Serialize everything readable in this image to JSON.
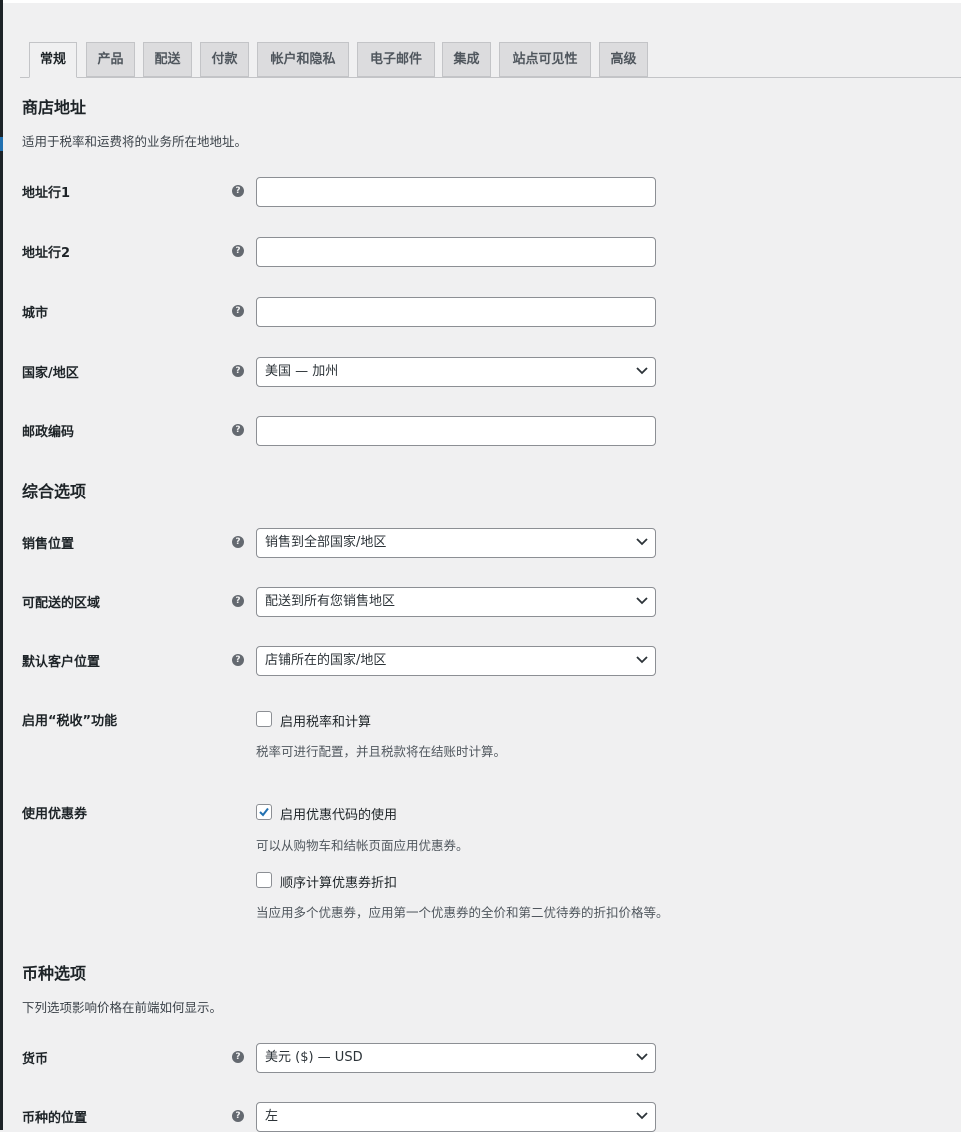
{
  "tabs": [
    {
      "label": "常规"
    },
    {
      "label": "产品"
    },
    {
      "label": "配送"
    },
    {
      "label": "付款"
    },
    {
      "label": "帐户和隐私"
    },
    {
      "label": "电子邮件"
    },
    {
      "label": "集成"
    },
    {
      "label": "站点可见性"
    },
    {
      "label": "高级"
    }
  ],
  "store_address": {
    "title": "商店地址",
    "description": "适用于税率和运费将的业务所在地地址。",
    "address1": {
      "label": "地址行1",
      "value": ""
    },
    "address2": {
      "label": "地址行2",
      "value": ""
    },
    "city": {
      "label": "城市",
      "value": ""
    },
    "country": {
      "label": "国家/地区",
      "value": "美国 — 加州"
    },
    "postcode": {
      "label": "邮政编码",
      "value": ""
    }
  },
  "general_options": {
    "title": "综合选项",
    "selling_location": {
      "label": "销售位置",
      "value": "销售到全部国家/地区"
    },
    "shipping_location": {
      "label": "可配送的区域",
      "value": "配送到所有您销售地区"
    },
    "default_customer_location": {
      "label": "默认客户位置",
      "value": "店铺所在的国家/地区"
    },
    "taxes": {
      "label": "启用“税收”功能",
      "checkbox_label": "启用税率和计算",
      "checked": false,
      "note": "税率可进行配置，并且税款将在结账时计算。"
    },
    "coupons": {
      "label": "使用优惠券",
      "enable_label": "启用优惠代码的使用",
      "enable_checked": true,
      "enable_note": "可以从购物车和结帐页面应用优惠券。",
      "sequential_label": "顺序计算优惠券折扣",
      "sequential_checked": false,
      "sequential_note": "当应用多个优惠券，应用第一个优惠券的全价和第二优待券的折扣价格等。"
    }
  },
  "currency_options": {
    "title": "币种选项",
    "description": "下列选项影响价格在前端如何显示。",
    "currency": {
      "label": "货币",
      "value": "美元 ($) — USD"
    },
    "position": {
      "label": "币种的位置",
      "value": "左"
    }
  },
  "help_icon_glyph": "?",
  "colors": {
    "accent": "#2271b1",
    "background": "#f0f0f1"
  }
}
